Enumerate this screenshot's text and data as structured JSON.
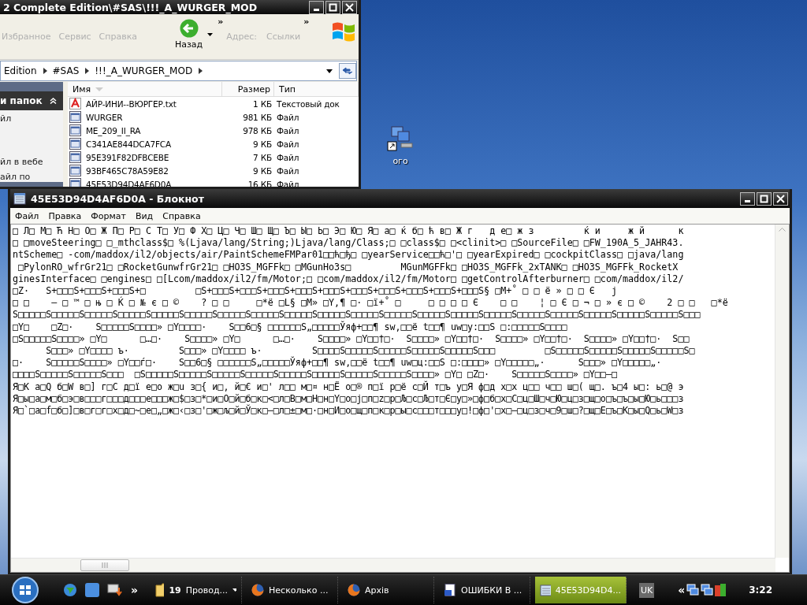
{
  "explorer": {
    "title": "2 Complete Edition\\#SAS\\!!!_A_WURGER_MOD",
    "menu": [
      "Избранное",
      "Сервис",
      "Справка"
    ],
    "back_button": "Назад",
    "toolbar_more": "»",
    "address_label": "Адрес:",
    "links_label": "Ссылки",
    "links_more": "»",
    "breadcrumb": [
      "Edition",
      "#SAS",
      "!!!_A_WURGER_MOD"
    ],
    "tasks_panel": {
      "header": "и папок",
      "items": [
        "йл",
        "йл в вебе",
        "айл по"
      ]
    },
    "columns": [
      "Имя",
      "Размер",
      "Тип"
    ],
    "files": [
      {
        "name": "АЙР-ИНИ--ВЮРГЕР.txt",
        "size": "1 КБ",
        "type": "Текстовый док",
        "kind": "text"
      },
      {
        "name": "WURGER",
        "size": "981 КБ",
        "type": "Файл",
        "kind": "file"
      },
      {
        "name": "ME_209_II_RA",
        "size": "978 КБ",
        "type": "Файл",
        "kind": "file"
      },
      {
        "name": "C341AE844DCA7FCA",
        "size": "9 КБ",
        "type": "Файл",
        "kind": "file"
      },
      {
        "name": "95E391F82DFBCEBE",
        "size": "7 КБ",
        "type": "Файл",
        "kind": "file"
      },
      {
        "name": "93BF465C78A59E82",
        "size": "9 КБ",
        "type": "Файл",
        "kind": "file"
      },
      {
        "name": "45E53D94D4AF6D0A",
        "size": "16 КБ",
        "type": "Файл",
        "kind": "file"
      }
    ]
  },
  "desktop_icons": [
    {
      "label": "ого"
    }
  ],
  "notepad": {
    "title": "45E53D94D4AF6D0A - Блокнот",
    "menu": [
      "Файл",
      "Правка",
      "Формат",
      "Вид",
      "Справка"
    ],
    "lines": [
      "□ Л□ М□ Ћ Н□ О□ Ж П□ Р□ С Т□ У□ Ф Х□ Ц□ Ч□ Ш□ Щ□ Ъ□ Ы□ Ь□ Э□ Ю□ Я□ а□ ќ б□ ћ в□ Ж г   д е□ ж з         ќ и     ж й      к",
      "□ □moveSteering□ □_mthclass$□ %(Ljava/lang/String;)Ljava/lang/Class;□ □class$□ □<clinit>□ □SourceFile□ □FW_190A_5_JAHR43.",
      "ntScheme□ -com/maddox/il2/objects/air/PaintSchemeFMPar01□□ћ□ђ□ □yearService□□ћ□'□ □yearExpired□ □cockpitClass□ □java/lang",
      " □PylonRO_wfrGr21□ □RocketGunwfrGr21□ □HO3S_MGFFk□ □MGunHo3s□         MGunMGFFk□ □HO3S_MGFFk_2xTANK□ □HO3S_MGFFk_RocketX",
      "ginesInterface□ □engines□ □[Lcom/maddox/il2/fm/Motor;□ □com/maddox/il2/fm/Motor□ □getControlAfterburner□ □com/maddox/il2/",
      "□Z·   S+□□□S+□□□S+□□□S+□         □S+□□□S+□□□S+□□□S+□□□S+□□□S+□□□S+□□□S+□□□S+□□□S+□□□S§ □M+˚ □ □ ё » □ □ Є   ј",
      "□ □    — □ ™ □ њ □ Ќ □ № є □ ©    ? □ □     □*ё □L§ □M» □Y,¶ □· □ї+˚ □     □ □ □ □ Є    □ □    ¦ □ Є □ ¬ □ » є □ ©    2 □ □   □*ё",
      "S□□□□□S□□□□□S□□□□□S□□□□□S□□□□□S□□□□□S□□□□□S□□□□□S□□□□□S□□□□□S□□□□□S□□□□□S□□□□□S□□□□□S□□□□□S□□□□□S□□□□□S□□□□□S□□□□□S□□□□□S□□□",
      "□Y□    □Z□·    S□□□□□S□□□□» □Y□□□□·    S□□6□§ □□□□□□S„□□□□□Ўяф+□□¶ sw,□□ё t□□¶ uw□y:□□S □:□□□□□S□□□□",
      "□S□□□□□S□□□□» □Y□      □…□·    S□□□□» □Y□      □…□·    S□□□□» □Y□□†□·  S□□□□» □Y□□†□·  S□□□□» □Y□□†□·  S□□□□» □Y□□†□·  S□□",
      "      S□□□» □Y□□□□ ъ·         S□□□» □Y□□□□ ъ·         S□□□□S□□□□□S□□□□□S□□□□□S□□□□□S□□□         □S□□□□□S□□□□□S□□□□□S□□□□□S□",
      "□·    S□□□□□S□□□□» □Y□□ѓ□·    S□□6□§ □□□□□□S„□□□□□Ўяф+□□¶ sw,□□ё t□□¶ uw□ц:□□S □:□□□□» □Y□□□□□„·      S□□□» □Y□□□□□„·",
      "□□□□S□□□□□S□□□□□S□□□  □S□□□□□S□□□□□S□□□□□S□□□□□S□□□□□S□□□□□S□□□□□S□□□□□S□□□□» □Y□ □Z□·    S□□□□□S□□□□» □Y□□–□",
      "Я□К а□Q б□W в□] г□С д□ї е□о ж□u з□{ и□, й□€ и□' л□□ м□¤ н□Ё о□® п□ї р□ё с□Й т□ъ у□Я ф□д х□х ц□□ ч□□ ш□( щ□. ъ□4 ы□: ь□@ э",
      "Я□ы□а□м□б□э□в□□□г□□□д□□□е□□□ж□$□з□*□и□О□й□б□к□<□л□В□м□Н□н□Y□о□ј□п□z□р□Љ□с□Љ□т□Є□у□»□ф□б□х□С□ц□Ш□ч□Ю□ц□з□щ□о□ъ□ъ□ы□Ю□ь□□□з",
      "Я□`□а□f□б□]□в□г□г□х□д□~□е□„□ж□‹□з□'□ж□љ□й□Ў□к□–□л□±□м□·□н□И□о□щ□п□к□р□ы□с□□□т□□□у□!□ф□'□х□–□ц□з□ч□9□ш□?□щ□Е□ъ□К□ы□Q□ь□W□з"
    ]
  },
  "taskbar": {
    "quick_launch_more": "»",
    "tasks": [
      {
        "label": "Провод...",
        "count": "19",
        "kind": "folder",
        "selected": false
      },
      {
        "label": "Несколько ...",
        "kind": "browser",
        "selected": false
      },
      {
        "label": "Архів",
        "kind": "browser",
        "selected": false
      },
      {
        "label": "ОШИБКИ В ...",
        "kind": "document",
        "selected": false
      },
      {
        "label": "45E53D94D4...",
        "kind": "notepad",
        "selected": true
      }
    ],
    "language": "UK",
    "tray_more": "«",
    "clock": "3:22"
  }
}
